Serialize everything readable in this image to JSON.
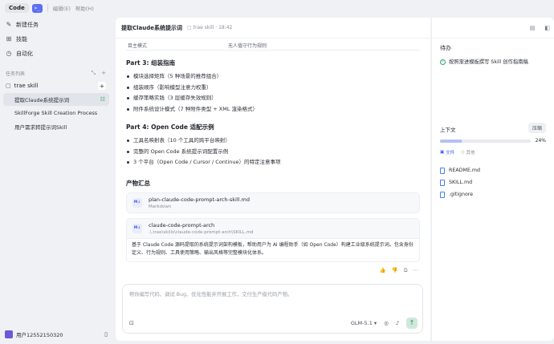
{
  "titlebar": {
    "app_name": "Code",
    "menu": [
      "编辑(E)",
      "帮助(H)"
    ]
  },
  "sidebar": {
    "nav": [
      {
        "label": "新建任务",
        "icon": "edit-icon"
      },
      {
        "label": "技能",
        "icon": "skills-icon"
      },
      {
        "label": "自动化",
        "icon": "clock-icon"
      }
    ],
    "section_label": "任务列表",
    "project": "trae skill",
    "tasks": [
      {
        "label": "提取Claude系统提示词",
        "active": true
      },
      {
        "label": "SkillForge Skill Creation Process",
        "active": false
      },
      {
        "label": "用户需求转提示词Skill",
        "active": false
      }
    ],
    "user": "用户12552150320"
  },
  "main": {
    "title": "提取Claude系统提示词",
    "project_tag": "trae skill",
    "time": "18:42",
    "table_row": [
      "目主模式",
      "无人值守行为规则"
    ],
    "part3_title": "Part 3: 组装指南",
    "part3_items": [
      "模块选择矩阵（5 种场景的推荐组合）",
      "组装顺序（影响模型注意力权重）",
      "缓存策略实践（3 层缓存失效规则）",
      "附件系统设计模式（7 种附件类型 + XML 渲染格式）"
    ],
    "part4_title": "Part 4: Open Code 适配示例",
    "part4_items": [
      "工具名映射表（10 个工具的跨平台映射）",
      "完整的 Open Code 系统提示词配置示例",
      "3 个平台（Open Code / Cursor / Continue）的特定注意事项"
    ],
    "artifacts_title": "产物汇总",
    "files": [
      {
        "badge": "M↓",
        "name": "plan-claude-code-prompt-arch-skill.md",
        "sub": "Markdown"
      },
      {
        "badge": "M↓",
        "name": "claude-code-prompt-arch",
        "sub": ".\\.trae\\skills\\claude-code-prompt-arch\\SKILL.md"
      }
    ],
    "file_desc": "基于 Claude Code 源码提取的系统提示词架构模板，帮助用户为 AI 编程助手（如 Open Code）构建工业级系统提示词。包含身份定义、行为规则、工具使用策略、输出风格等完整模块化体系。",
    "composer_placeholder": "帮你编写代码、调试 Bug、优化性能并开展工作，交付生产级代码产物。",
    "model": "GLM-5.1"
  },
  "right": {
    "todo_title": "待办",
    "todo_item": "按照渐进模板撰写 Skill 创作指南稿",
    "context_title": "上下文",
    "compress_label": "压缩",
    "context_pct": "24%",
    "context_fraction": 0.24,
    "tabs": [
      "文件",
      "其他"
    ],
    "files": [
      "README.md",
      "SKILL.md",
      ".gitignore"
    ]
  },
  "colors": {
    "accent_green": "#2fa56a",
    "accent_blue": "#2d5df0"
  }
}
